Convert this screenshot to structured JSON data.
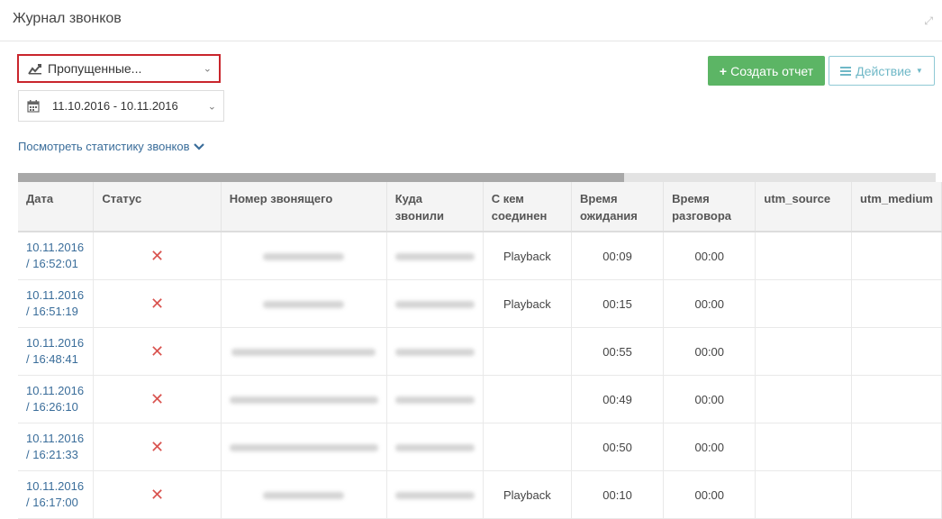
{
  "window": {
    "title": "Журнал звонков"
  },
  "filters": {
    "type_select": "Пропущенные...",
    "date_range": "11.10.2016 - 10.11.2016",
    "stats_link": "Посмотреть статистику звонков"
  },
  "toolbar": {
    "create_report": "Создать отчет",
    "action": "Действие"
  },
  "colors": {
    "accent_green": "#5cb565",
    "link_blue": "#3a6d9a",
    "missed_red": "#d9534f",
    "highlight_red": "#c9252c"
  },
  "table": {
    "columns": [
      "Дата",
      "Статус",
      "Номер звонящего",
      "Куда звонили",
      "С кем соединен",
      "Время ожидания",
      "Время разговора",
      "utm_source",
      "utm_medium"
    ],
    "rows": [
      {
        "date": "10.11.2016",
        "time": "/ 16:52:01",
        "status": "missed",
        "connected": "Playback",
        "wait": "00:09",
        "talk": "00:00"
      },
      {
        "date": "10.11.2016",
        "time": "/ 16:51:19",
        "status": "missed",
        "connected": "Playback",
        "wait": "00:15",
        "talk": "00:00"
      },
      {
        "date": "10.11.2016",
        "time": "/ 16:48:41",
        "status": "missed",
        "connected": "",
        "wait": "00:55",
        "talk": "00:00"
      },
      {
        "date": "10.11.2016",
        "time": "/ 16:26:10",
        "status": "missed",
        "connected": "",
        "wait": "00:49",
        "talk": "00:00"
      },
      {
        "date": "10.11.2016",
        "time": "/ 16:21:33",
        "status": "missed",
        "connected": "",
        "wait": "00:50",
        "talk": "00:00"
      },
      {
        "date": "10.11.2016",
        "time": "/ 16:17:00",
        "status": "missed",
        "connected": "Playback",
        "wait": "00:10",
        "talk": "00:00"
      }
    ]
  },
  "horizontal_scroll": {
    "position_fraction": 0.66
  }
}
